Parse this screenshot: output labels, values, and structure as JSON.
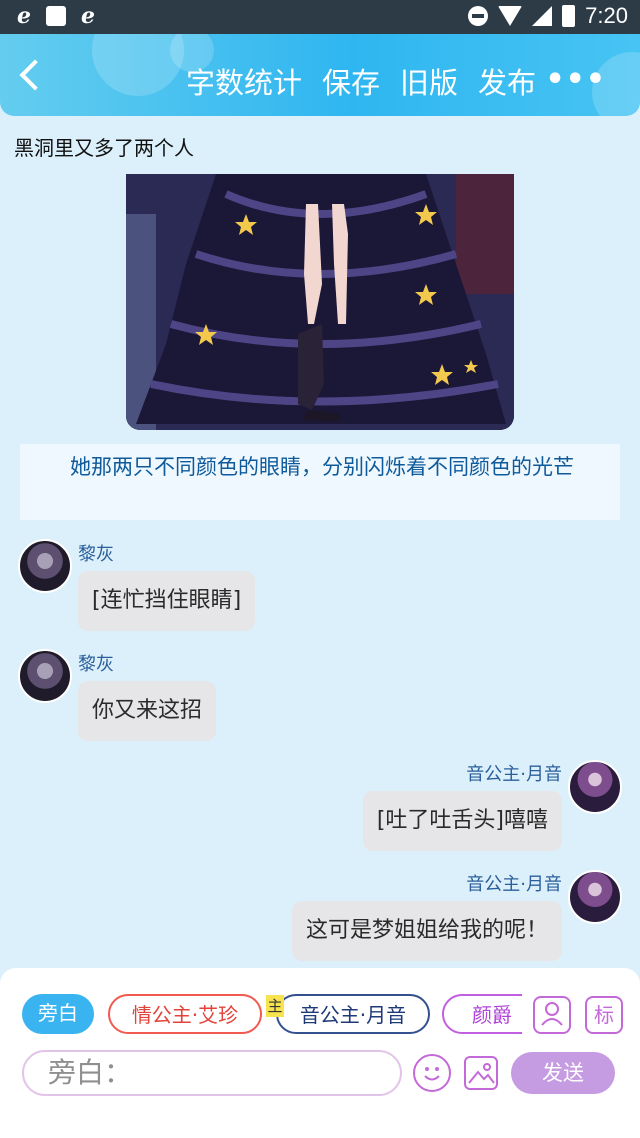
{
  "status_bar": {
    "left_icons": [
      "e",
      "e"
    ],
    "time": "7:20"
  },
  "header": {
    "actions": [
      "字数统计",
      "保存",
      "旧版",
      "发布"
    ],
    "more_label": "•••"
  },
  "story": {
    "title": "黑洞里又多了两个人",
    "narration": "她那两只不同颜色的眼睛，分别闪烁着不同颜色的光芒"
  },
  "messages": [
    {
      "speaker": "黎灰",
      "text": "[连忙挡住眼睛]",
      "side": "left",
      "avatar": "lihui-avatar"
    },
    {
      "speaker": "黎灰",
      "text": "你又来这招",
      "side": "left",
      "avatar": "lihui-avatar"
    },
    {
      "speaker": "音公主·月音",
      "text": "[吐了吐舌头]嘻嘻",
      "side": "right",
      "avatar": "yuein-avatar"
    },
    {
      "speaker": "音公主·月音",
      "text": "这可是梦姐姐给我的呢！",
      "side": "right",
      "avatar": "yuein-avatar"
    }
  ],
  "composer": {
    "roles": [
      "旁白",
      "情公主·艾珍",
      "音公主·月音",
      "颜爵"
    ],
    "main_tag": "主",
    "tool_label": "标",
    "input_value": "旁白：",
    "send_label": "发送"
  },
  "colors": {
    "header_accent": "#2fb6f0",
    "narration_text": "#0f5a9a",
    "send_button": "#c59be2"
  }
}
